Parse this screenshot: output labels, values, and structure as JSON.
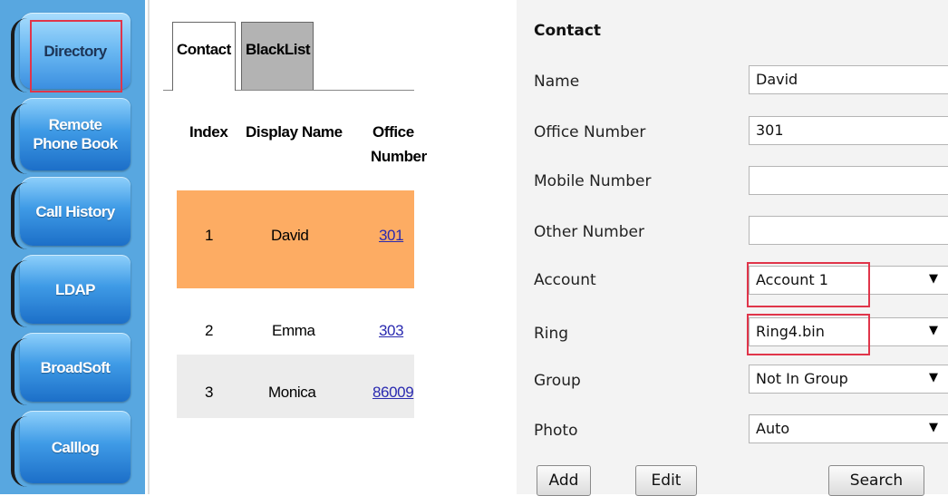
{
  "nav": {
    "items": [
      {
        "label": "Directory"
      },
      {
        "label": "Remote Phone Book"
      },
      {
        "label": "Call History"
      },
      {
        "label": "LDAP"
      },
      {
        "label": "BroadSoft"
      },
      {
        "label": "Calllog"
      }
    ]
  },
  "tabs": {
    "contact": "Contact",
    "blacklist": "BlackList"
  },
  "table": {
    "headers": {
      "index": "Index",
      "display_name": "Display Name",
      "office_number_1": "Office",
      "office_number_2": "Number"
    },
    "rows": [
      {
        "index": "1",
        "name": "David",
        "office": "301"
      },
      {
        "index": "2",
        "name": "Emma",
        "office": "303"
      },
      {
        "index": "3",
        "name": "Monica",
        "office": "86009"
      }
    ]
  },
  "form": {
    "title": "Contact",
    "labels": {
      "name": "Name",
      "office_number": "Office Number",
      "mobile_number": "Mobile Number",
      "other_number": "Other Number",
      "account": "Account",
      "ring": "Ring",
      "group": "Group",
      "photo": "Photo"
    },
    "values": {
      "name": "David",
      "office_number": "301",
      "mobile_number": "",
      "other_number": "",
      "account": "Account 1",
      "ring": "Ring4.bin",
      "group": "Not In Group",
      "photo": "Auto"
    },
    "buttons": {
      "add": "Add",
      "edit": "Edit",
      "search": "Search"
    },
    "dropdown_arrow": "▼"
  },
  "colors": {
    "highlight": "#e0354a",
    "selected_row": "#fdac63",
    "nav_background": "#58a7e0"
  }
}
